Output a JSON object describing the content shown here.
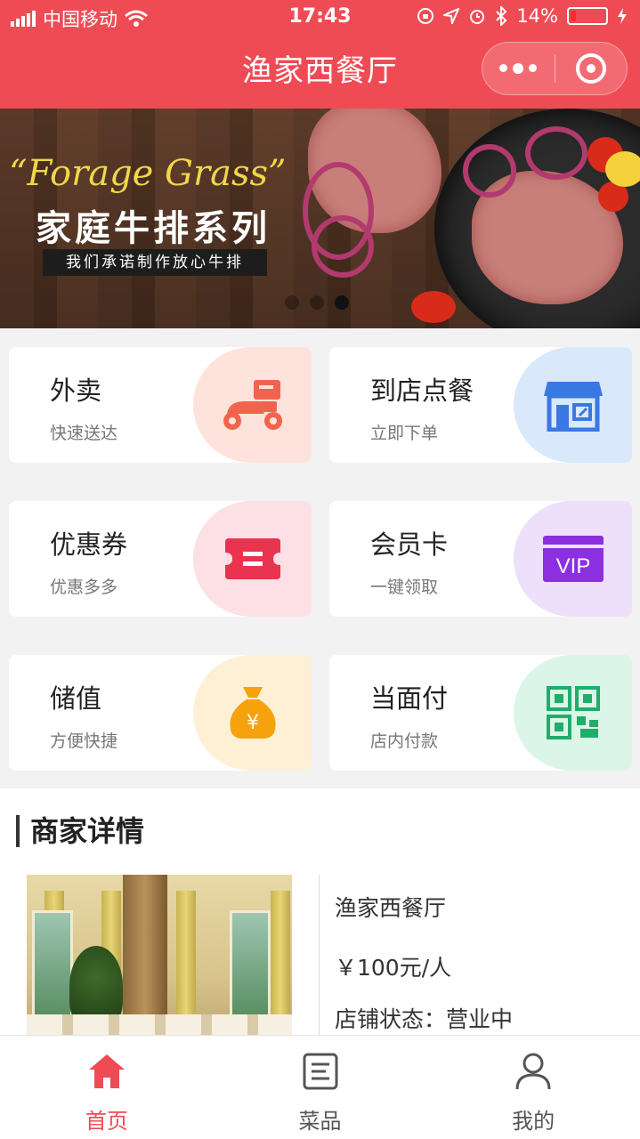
{
  "status_bar": {
    "carrier": "中国移动",
    "time": "17:43",
    "battery": "14%"
  },
  "nav": {
    "title": "渔家西餐厅"
  },
  "banner": {
    "title": "“Forage Grass”",
    "subtitle": "家庭牛排系列",
    "tagline": "我们承诺制作放心牛排",
    "slide_count": 3,
    "active_slide": 3
  },
  "services": [
    {
      "title": "外卖",
      "subtitle": "快速送达",
      "icon": "scooter-icon",
      "color": "#f2634d",
      "bg": "#fde3dc"
    },
    {
      "title": "到店点餐",
      "subtitle": "立即下单",
      "icon": "storefront-icon",
      "color": "#3a78e3",
      "bg": "#d9e8fb"
    },
    {
      "title": "优惠券",
      "subtitle": "优惠多多",
      "icon": "coupon-icon",
      "color": "#e8344f",
      "bg": "#fde0e6"
    },
    {
      "title": "会员卡",
      "subtitle": "一键领取",
      "icon": "vip-card-icon",
      "color": "#8b2fe0",
      "bg": "#eedffb"
    },
    {
      "title": "储值",
      "subtitle": "方便快捷",
      "icon": "money-bag-icon",
      "color": "#f5a20c",
      "bg": "#fdf0d5"
    },
    {
      "title": "当面付",
      "subtitle": "店内付款",
      "icon": "qr-code-icon",
      "color": "#1eae6a",
      "bg": "#dcf5e9"
    }
  ],
  "merchant": {
    "heading": "商家详情",
    "name": "渔家西餐厅",
    "price": "￥100元/人",
    "status": "店铺状态：营业中"
  },
  "tabbar": {
    "items": [
      {
        "label": "首页",
        "icon": "home-icon",
        "active": true
      },
      {
        "label": "菜品",
        "icon": "menu-list-icon",
        "active": false
      },
      {
        "label": "我的",
        "icon": "user-icon",
        "active": false
      }
    ]
  },
  "colors": {
    "brand": "#ef4b55",
    "page_bg": "#f2f2f2"
  }
}
